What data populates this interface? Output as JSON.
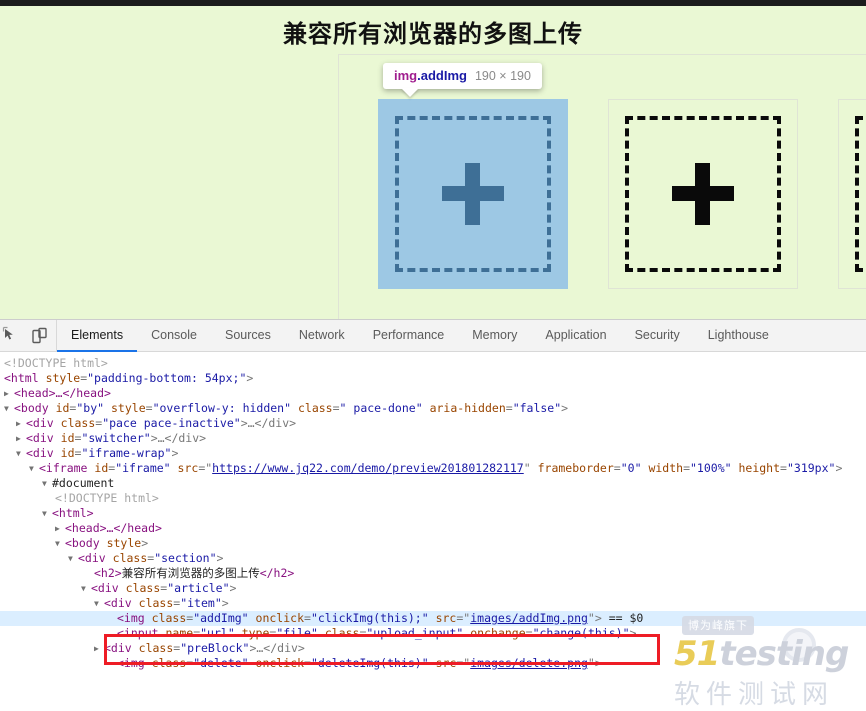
{
  "page": {
    "title": "兼容所有浏览器的多图上传",
    "background_color": "#eaf8d4",
    "items": [
      {
        "name": "add-image-placeholder",
        "selected": true,
        "label": ""
      },
      {
        "name": "add-image-placeholder",
        "selected": false,
        "label": ""
      },
      {
        "name": "add-image-placeholder",
        "selected": false,
        "label": ""
      }
    ]
  },
  "highlight_tooltip": {
    "tag": "img",
    "class": ".addImg",
    "dimensions": "190 × 190",
    "tag_color": "#a01d8e",
    "class_color": "#1a1aa6"
  },
  "devtools": {
    "icons": [
      {
        "name": "inspect-element-icon",
        "glyph": "inspect"
      },
      {
        "name": "device-toolbar-icon",
        "glyph": "device"
      }
    ],
    "tabs": [
      {
        "label": "Elements",
        "active": true
      },
      {
        "label": "Console",
        "active": false
      },
      {
        "label": "Sources",
        "active": false
      },
      {
        "label": "Network",
        "active": false
      },
      {
        "label": "Performance",
        "active": false
      },
      {
        "label": "Memory",
        "active": false
      },
      {
        "label": "Application",
        "active": false
      },
      {
        "label": "Security",
        "active": false
      },
      {
        "label": "Lighthouse",
        "active": false
      }
    ],
    "active_tab_underline_color": "#1a73e8",
    "selected_row_background": "#dbeeff",
    "annotation_box_color": "#ee1c25",
    "dom": {
      "line_doctype": "<!DOCTYPE html>",
      "l01_tag_open": "<html",
      "l01_attr": "style",
      "l01_val": "\"padding-bottom: 54px;\"",
      "l01_close": ">",
      "l02": "<head>…</head>",
      "l03_open": "<body",
      "l03_attr1": "id",
      "l03_val1": "\"by\"",
      "l03_attr2": "style",
      "l03_val2": "\"overflow-y: hidden\"",
      "l03_attr3": "class",
      "l03_val3": "\"  pace-done\"",
      "l03_attr4": "aria-hidden",
      "l03_val4": "\"false\"",
      "l03_close": ">",
      "l04_open": "<div",
      "l04_attr": "class",
      "l04_val": "\"pace  pace-inactive\"",
      "l04_close": ">…</div>",
      "l05_open": "<div",
      "l05_attr": "id",
      "l05_val": "\"switcher\"",
      "l05_close": ">…</div>",
      "l06_open": "<div",
      "l06_attr": "id",
      "l06_val": "\"iframe-wrap\"",
      "l06_close": ">",
      "l07_open": "<iframe",
      "l07_attr1": "id",
      "l07_val1": "\"iframe\"",
      "l07_attr2": "src",
      "l07_link": "https://www.jq22.com/demo/preview201801282117",
      "l07_attr3": "frameborder",
      "l07_val3": "\"0\"",
      "l07_attr4": "width",
      "l07_val4": "\"100%\"",
      "l07_attr5": "height",
      "l07_val5": "\"319px\"",
      "l07_close": ">",
      "l08": "#document",
      "l09": "<!DOCTYPE html>",
      "l10": "<html>",
      "l11": "<head>…</head>",
      "l12_open": "<body",
      "l12_attr": "style",
      "l12_close": ">",
      "l13_open": "<div",
      "l13_attr": "class",
      "l13_val": "\"section\"",
      "l13_close": ">",
      "l14_open": "<h2>",
      "l14_text": "兼容所有浏览器的多图上传",
      "l14_close": "</h2>",
      "l15_open": "<div",
      "l15_attr": "class",
      "l15_val": "\"article\"",
      "l15_close": ">",
      "l16_open": "<div",
      "l16_attr": "class",
      "l16_val": "\"item\"",
      "l16_close": ">",
      "l17_open": "<img",
      "l17_attr1": "class",
      "l17_val1": "\"addImg\"",
      "l17_attr2": "onclick",
      "l17_val2": "\"clickImg(this);\"",
      "l17_attr3": "src",
      "l17_link": "images/addImg.png",
      "l17_close": ">",
      "l17_marker": "== $0",
      "l18_open": "<input",
      "l18_attr1": "name",
      "l18_val1": "\"url\"",
      "l18_attr2": "type",
      "l18_val2": "\"file\"",
      "l18_attr3": "class",
      "l18_val3": "\"upload_input\"",
      "l18_attr4": "onchange",
      "l18_val4": "\"change(this)\"",
      "l18_close": ">",
      "l19_open": "<div",
      "l19_attr": "class",
      "l19_val": "\"preBlock\"",
      "l19_close": ">…</div>",
      "l20_open": "<img",
      "l20_attr1": "class",
      "l20_val1": "\"delete\"",
      "l20_attr2": "onclick",
      "l20_val2": "\"deleteImg(this)\"",
      "l20_attr3": "src",
      "l20_link": "images/delete.png",
      "l20_close": ">"
    }
  },
  "watermark": {
    "tag": "博为峰旗下",
    "brand_number": "51",
    "brand_word": "testing",
    "subtitle": "软件测试网"
  }
}
